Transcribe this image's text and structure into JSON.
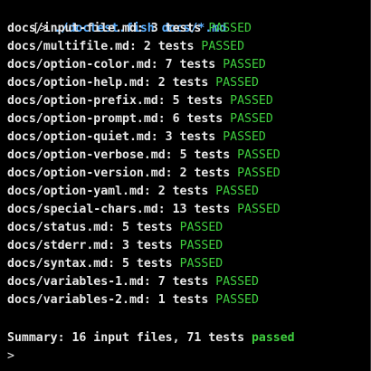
{
  "terminal": {
    "prompt_symbol": "[>",
    "command": " ./doctest.fish docs/*.md",
    "results": [
      {
        "file": "docs/input-file.md:",
        "count": " 3 tests ",
        "status": "PASSED"
      },
      {
        "file": "docs/multifile.md:",
        "count": " 2 tests ",
        "status": "PASSED"
      },
      {
        "file": "docs/option-color.md:",
        "count": " 7 tests ",
        "status": "PASSED"
      },
      {
        "file": "docs/option-help.md:",
        "count": " 2 tests ",
        "status": "PASSED"
      },
      {
        "file": "docs/option-prefix.md:",
        "count": " 5 tests ",
        "status": "PASSED"
      },
      {
        "file": "docs/option-prompt.md:",
        "count": " 6 tests ",
        "status": "PASSED"
      },
      {
        "file": "docs/option-quiet.md:",
        "count": " 3 tests ",
        "status": "PASSED"
      },
      {
        "file": "docs/option-verbose.md:",
        "count": " 5 tests ",
        "status": "PASSED"
      },
      {
        "file": "docs/option-version.md:",
        "count": " 2 tests ",
        "status": "PASSED"
      },
      {
        "file": "docs/option-yaml.md:",
        "count": " 2 tests ",
        "status": "PASSED"
      },
      {
        "file": "docs/special-chars.md:",
        "count": " 13 tests ",
        "status": "PASSED"
      },
      {
        "file": "docs/status.md:",
        "count": " 5 tests ",
        "status": "PASSED"
      },
      {
        "file": "docs/stderr.md:",
        "count": " 3 tests ",
        "status": "PASSED"
      },
      {
        "file": "docs/syntax.md:",
        "count": " 5 tests ",
        "status": "PASSED"
      },
      {
        "file": "docs/variables-1.md:",
        "count": " 7 tests ",
        "status": "PASSED"
      },
      {
        "file": "docs/variables-2.md:",
        "count": " 1 tests ",
        "status": "PASSED"
      }
    ],
    "summary_prefix": "Summary: 16 input files, 71 tests ",
    "summary_status": "passed",
    "cursor_prompt": ">"
  },
  "colors": {
    "background": "#000000",
    "text": "#e8e8e8",
    "command": "#5cb0ff",
    "passed": "#3fcf3f"
  }
}
